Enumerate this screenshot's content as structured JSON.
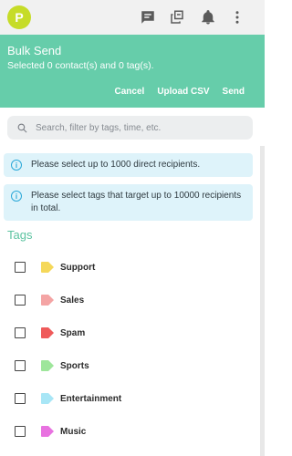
{
  "header": {
    "avatar_letter": "P",
    "icons": [
      "chat-icon",
      "copy-icon",
      "bell-icon",
      "more-vert-icon"
    ]
  },
  "panel": {
    "title": "Bulk Send",
    "subtitle": "Selected 0 contact(s) and 0 tag(s).",
    "actions": {
      "cancel": "Cancel",
      "upload": "Upload CSV",
      "send": "Send"
    }
  },
  "search": {
    "placeholder": "Search, filter by tags, time, etc."
  },
  "info": {
    "direct": "Please select up to 1000 direct recipients.",
    "tags": "Please select tags that target up to 10000 recipients in total."
  },
  "tags_heading": "Tags",
  "tags": [
    {
      "label": "Support",
      "color": "#f5d85a"
    },
    {
      "label": "Sales",
      "color": "#f4a4a4"
    },
    {
      "label": "Spam",
      "color": "#ef5a5a"
    },
    {
      "label": "Sports",
      "color": "#9ee69b"
    },
    {
      "label": "Entertainment",
      "color": "#a8e6f6"
    },
    {
      "label": "Music",
      "color": "#e872e0"
    }
  ],
  "colors": {
    "accent": "#66cdaa",
    "info_bg": "#def3fa",
    "info_icon": "#2aa8d8",
    "avatar": "#c6dc28"
  }
}
